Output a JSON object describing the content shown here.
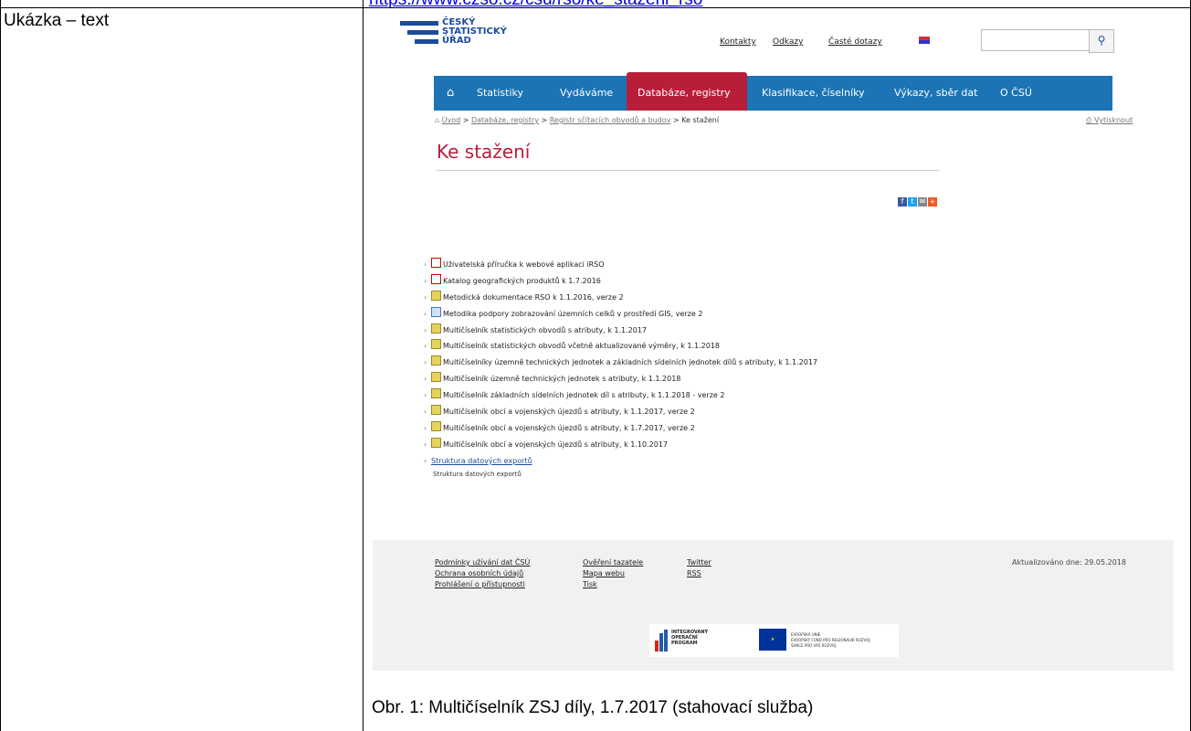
{
  "top_link": "https://www.czso.cz/csu/rso/ke_stazeni_rso",
  "label_cell": "Ukázka – text",
  "caption": "Obr. 1: Multičíselník ZSJ díly, 1.7.2017 (stahovací služba)",
  "site": {
    "logo_lines": [
      "ČESKÝ",
      "STATISTICKÝ",
      "ÚŘAD"
    ],
    "top_links": [
      "Kontakty",
      "Odkazy",
      "Časté dotazy"
    ],
    "nav": [
      "Statistiky",
      "Vydáváme",
      "Databáze, registry",
      "Klasifikace, číselníky",
      "Výkazy, sběr dat",
      "O ČSÚ"
    ],
    "breadcrumb": {
      "home": "Úvod",
      "items": [
        "Databáze, registry",
        "Registr sčítacích obvodů a budov"
      ],
      "current": "Ke stažení"
    },
    "print_label": "Vytisknout",
    "heading": "Ke stažení",
    "social": [
      "f",
      "t",
      "✉",
      "+"
    ],
    "files": [
      {
        "icon": "pdf",
        "label": "Uživatelská příručka k webové aplikaci iRSO"
      },
      {
        "icon": "pdf",
        "label": "Katalog geografických produktů k 1.7.2016"
      },
      {
        "icon": "zip",
        "label": "Metodická dokumentace RSO k 1.1.2016, verze 2"
      },
      {
        "icon": "doc",
        "label": "Metodika podpory zobrazování územních celků v prostředí GIS, verze 2"
      },
      {
        "icon": "zip",
        "label": "Multičíselník statistických obvodů s atributy, k 1.1.2017"
      },
      {
        "icon": "zip",
        "label": "Multičíselník statistických obvodů včetně aktualizované výměry, k 1.1.2018"
      },
      {
        "icon": "zip",
        "label": "Multičíselníky územně technických jednotek a základních sídelních jednotek dílů s atributy, k 1.1.2017"
      },
      {
        "icon": "zip",
        "label": "Multičíselník územně technických jednotek s atributy, k 1.1.2018"
      },
      {
        "icon": "zip",
        "label": "Multičíselník základních sídelních jednotek díl s atributy, k 1.1.2018 - verze 2"
      },
      {
        "icon": "zip",
        "label": "Multičíselník obcí a vojenských újezdů s atributy, k 1.1.2017, verze 2"
      },
      {
        "icon": "zip",
        "label": "Multičíselník obcí a vojenských újezdů s atributy, k 1.7.2017, verze 2"
      },
      {
        "icon": "zip",
        "label": "Multičíselník obcí a vojenských újezdů s atributy, k 1.10.2017"
      }
    ],
    "structure_link": "Struktura datových exportů",
    "structure_sub": "Struktura datových exportů",
    "footer": {
      "col1": [
        "Podmínky užívání dat ČSÚ",
        "Ochrana osobních údajů",
        "Prohlášení o přístupnosti"
      ],
      "col2": [
        "Ověření tazatele",
        "Mapa webu",
        "Tisk"
      ],
      "col3": [
        "Twitter",
        "RSS"
      ],
      "updated": "Aktualizováno dne: 29.05.2018",
      "iop_lines": [
        "INTEGROVANÝ",
        "OPERAČNÍ",
        "PROGRAM"
      ],
      "eu_lines": [
        "EVROPSKÁ UNIE",
        "EVROPSKÝ FOND PRO REGIONÁLNÍ ROZVOJ",
        "ŠANCE PRO VÁŠ ROZVOJ"
      ]
    }
  }
}
